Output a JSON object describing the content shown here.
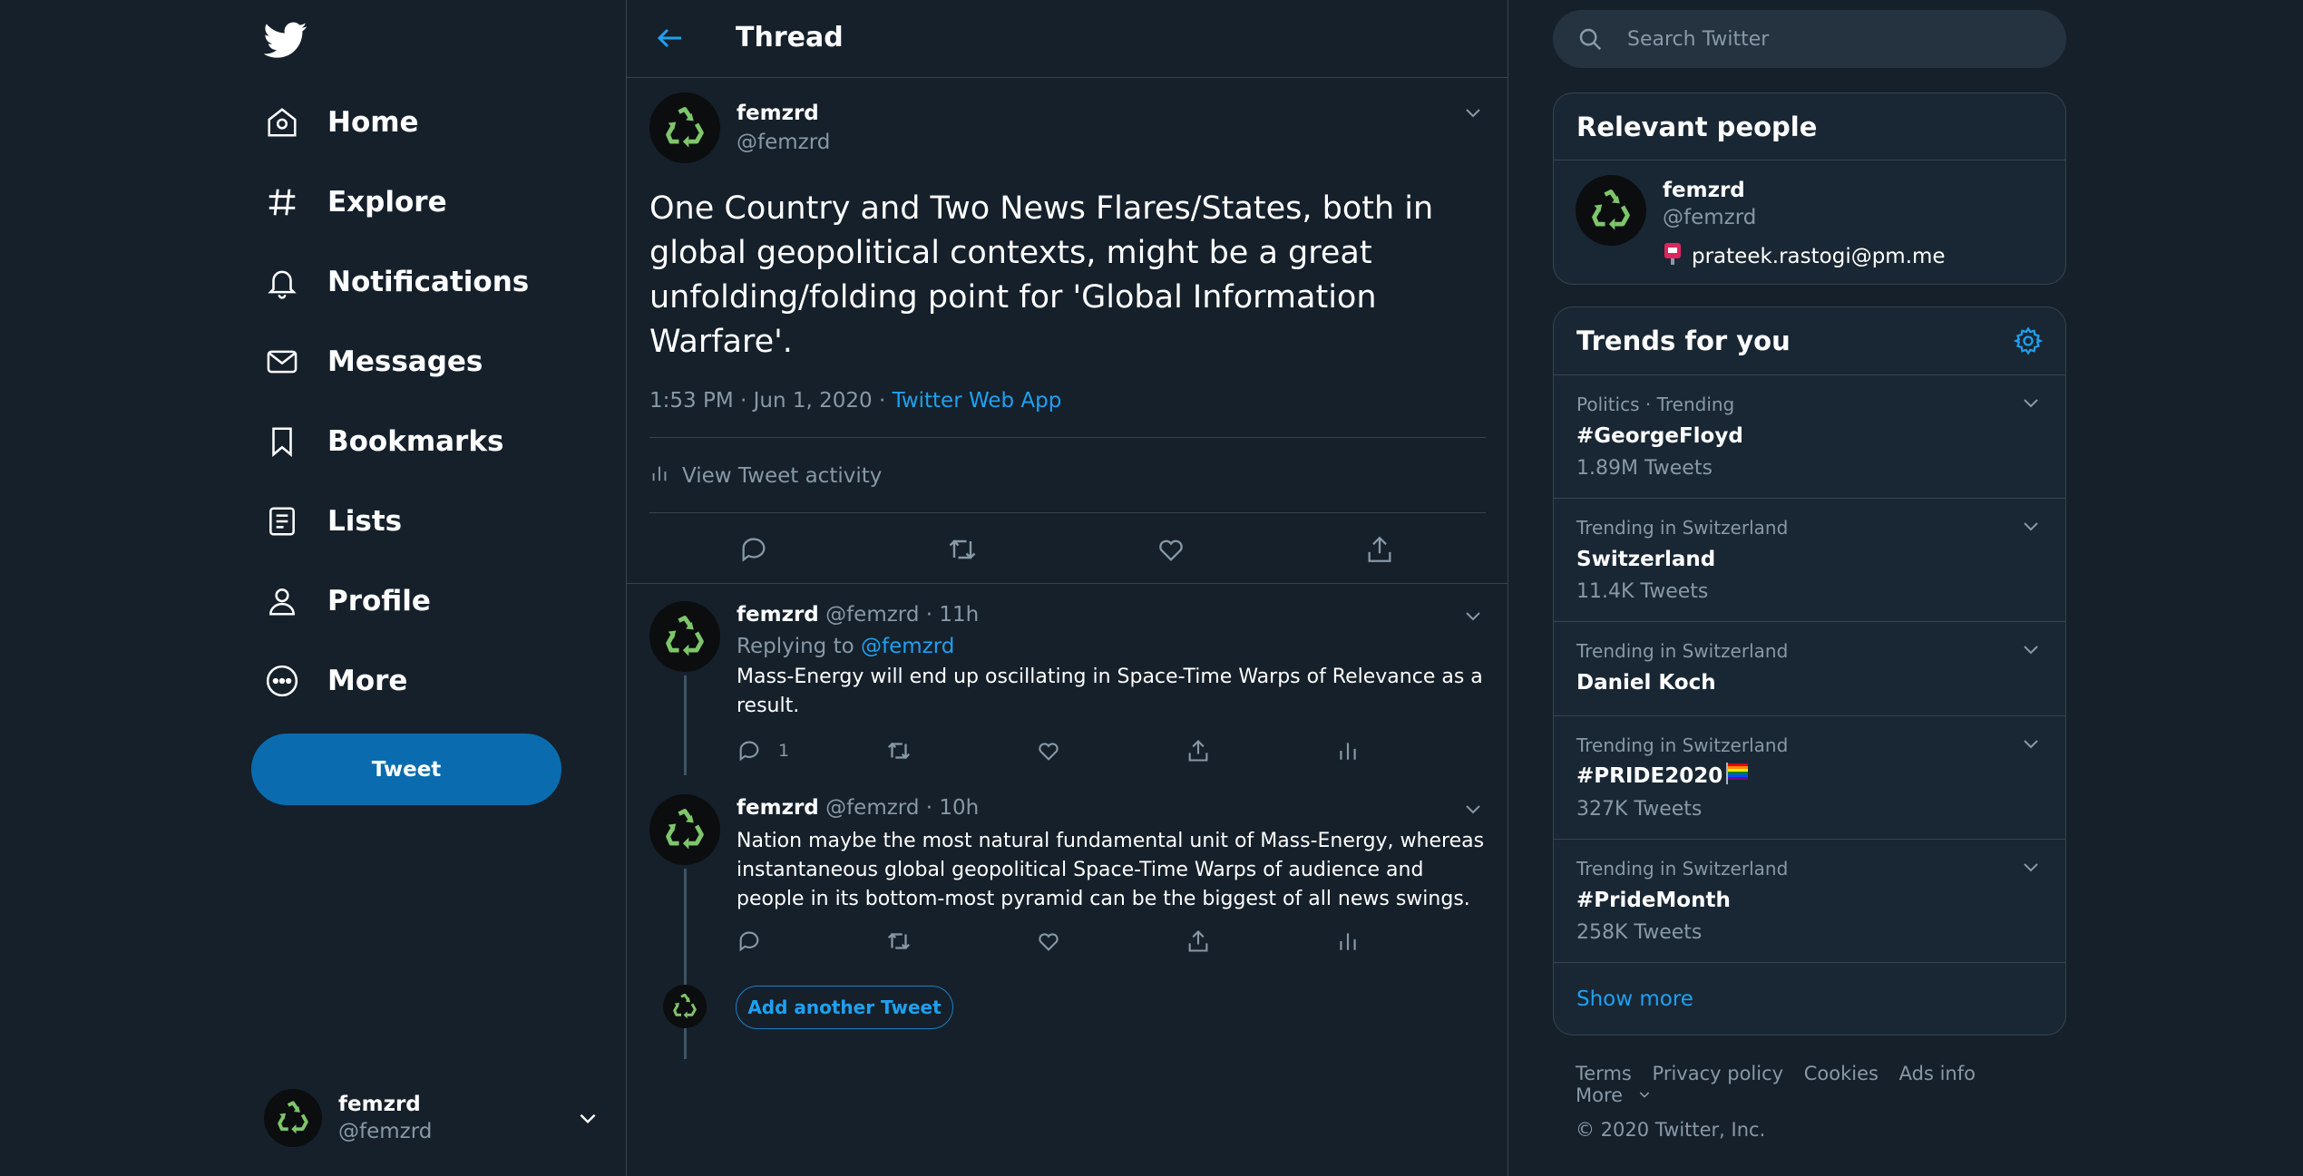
{
  "sidebar": {
    "nav": [
      {
        "label": "Home",
        "icon": "home-icon"
      },
      {
        "label": "Explore",
        "icon": "hashtag-icon"
      },
      {
        "label": "Notifications",
        "icon": "bell-icon"
      },
      {
        "label": "Messages",
        "icon": "envelope-icon"
      },
      {
        "label": "Bookmarks",
        "icon": "bookmark-icon"
      },
      {
        "label": "Lists",
        "icon": "list-icon"
      },
      {
        "label": "Profile",
        "icon": "person-icon"
      },
      {
        "label": "More",
        "icon": "more-circle-icon"
      }
    ],
    "tweet_button": "Tweet",
    "account": {
      "name": "femzrd",
      "handle": "@femzrd"
    }
  },
  "header": {
    "title": "Thread"
  },
  "main_tweet": {
    "name": "femzrd",
    "handle": "@femzrd",
    "text": "One Country and Two News Flares/States, both in global geopolitical contexts, might be a great unfolding/folding point for 'Global Information Warfare'.",
    "time": "1:53 PM · Jun 1, 2020 · ",
    "source": "Twitter Web App",
    "activity": "View Tweet activity"
  },
  "replies": [
    {
      "name": "femzrd",
      "meta": "@femzrd · 11h",
      "replying_prefix": "Replying to ",
      "replying_handle": "@femzrd",
      "text": "Mass-Energy will end up oscillating in Space-Time Warps of Relevance as a result.",
      "reply_count": "1"
    },
    {
      "name": "femzrd",
      "meta": "@femzrd · 10h",
      "text": "Nation maybe the most natural fundamental unit of Mass-Energy, whereas instantaneous global geopolitical Space-Time Warps of audience and people in its bottom-most pyramid can be the biggest of all news swings."
    }
  ],
  "add_tweet": "Add another Tweet",
  "search": {
    "placeholder": "Search Twitter"
  },
  "relevant": {
    "title": "Relevant people",
    "name": "femzrd",
    "handle": "@femzrd",
    "bio": "prateek.rastogi@pm.me"
  },
  "trends": {
    "title": "Trends for you",
    "items": [
      {
        "context": "Politics · Trending",
        "name": "#GeorgeFloyd",
        "count": "1.89M Tweets"
      },
      {
        "context": "Trending in Switzerland",
        "name": "Switzerland",
        "count": "11.4K Tweets"
      },
      {
        "context": "Trending in Switzerland",
        "name": "Daniel Koch",
        "count": ""
      },
      {
        "context": "Trending in Switzerland",
        "name": "#PRIDE2020",
        "count": "327K Tweets"
      },
      {
        "context": "Trending in Switzerland",
        "name": "#PrideMonth",
        "count": "258K Tweets"
      }
    ],
    "show_more": "Show more"
  },
  "footer": {
    "links": [
      "Terms",
      "Privacy policy",
      "Cookies",
      "Ads info",
      "More"
    ],
    "copyright": "© 2020 Twitter, Inc."
  },
  "colors": {
    "background": "#15202b",
    "panel": "#192734",
    "accent": "#1da1f2",
    "muted": "#8899a6",
    "border": "#38444d",
    "avatar_icon": "#7ec66b"
  }
}
